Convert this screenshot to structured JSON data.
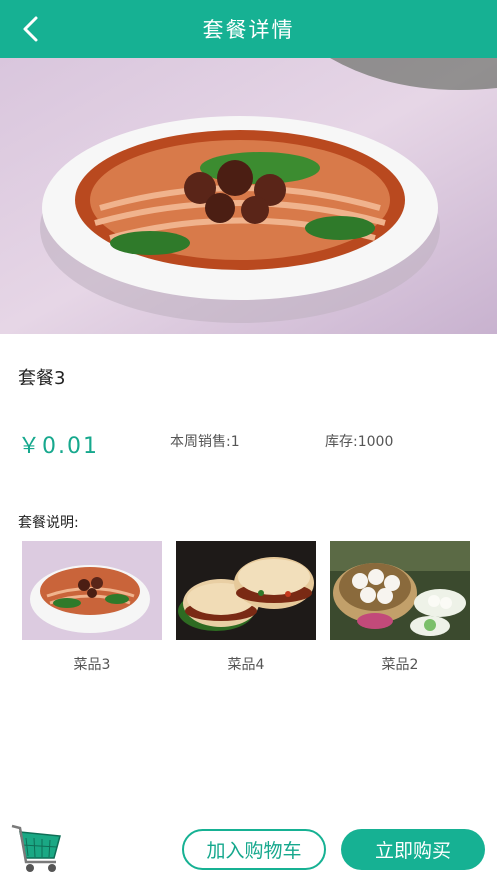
{
  "header": {
    "title": "套餐详情"
  },
  "package": {
    "name": "套餐3",
    "price": "￥0.01",
    "weekly_sales": "本周销售:1",
    "stock": "库存:1000",
    "description_label": "套餐说明:"
  },
  "dishes": [
    {
      "name": "菜品3",
      "image": "noodle-bowl"
    },
    {
      "name": "菜品4",
      "image": "roujiamo"
    },
    {
      "name": "菜品2",
      "image": "steamed-buns"
    }
  ],
  "actions": {
    "add_to_cart": "加入购物车",
    "buy_now": "立即购买"
  },
  "colors": {
    "accent": "#16b193",
    "price": "#16a88d"
  }
}
